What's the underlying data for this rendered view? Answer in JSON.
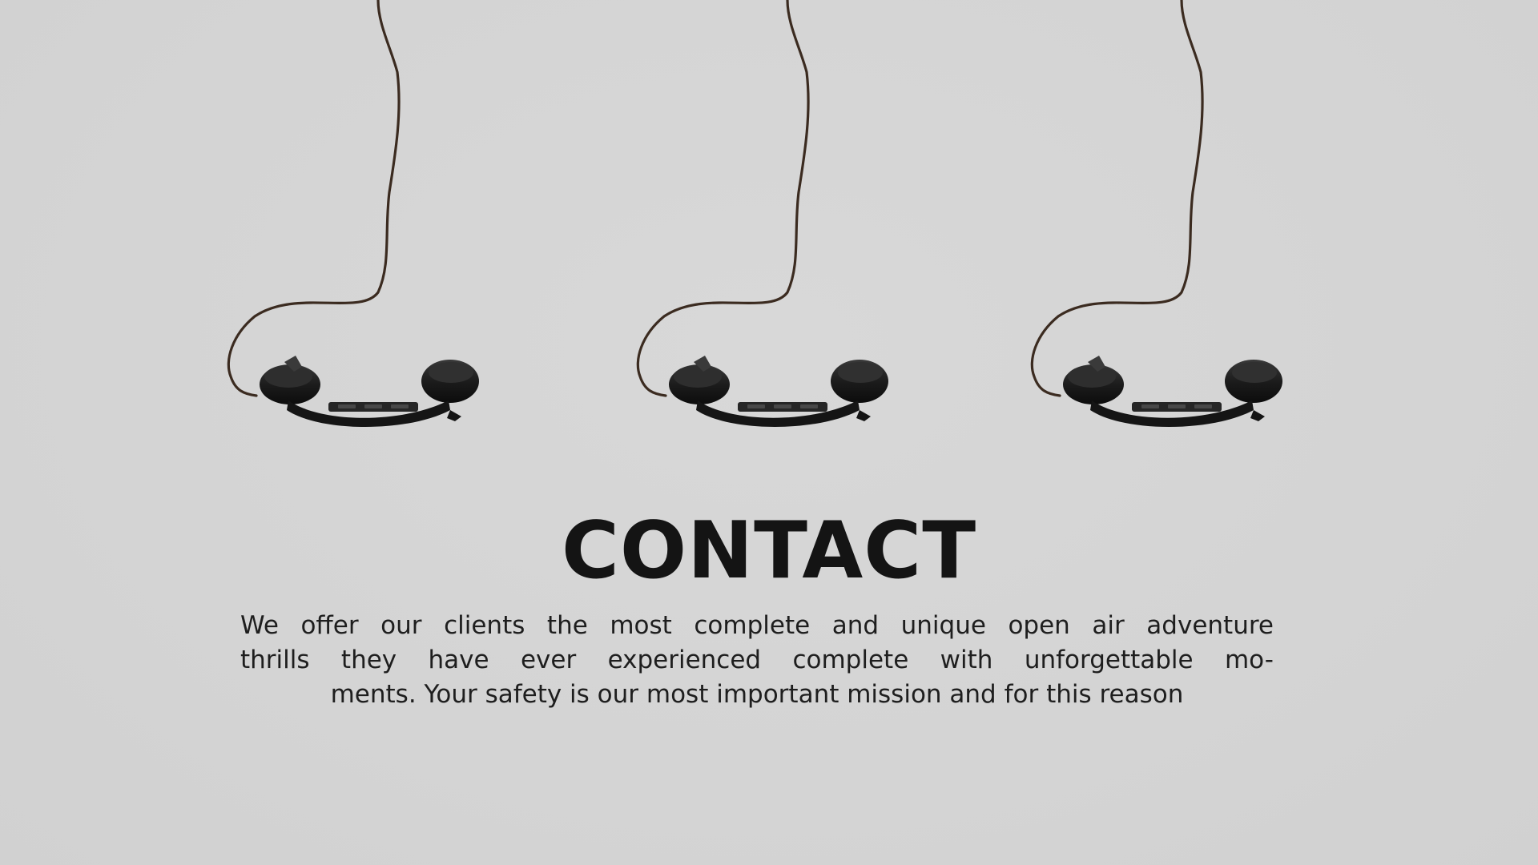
{
  "contact": {
    "title": "CONTACT",
    "description_lines": [
      "We offer our clients the most complete and unique open air adventure",
      "thrills they have ever experienced complete with unforgettable mo-",
      "ments. Your safety is our most important mission and for this reason"
    ]
  },
  "images": {
    "phones": [
      {
        "name": "hanging-telephone-receiver-icon"
      },
      {
        "name": "hanging-telephone-receiver-icon"
      },
      {
        "name": "hanging-telephone-receiver-icon"
      }
    ]
  },
  "colors": {
    "background": "#d4d4d4",
    "cord": "#3b2b20",
    "receiver": "#1b1b1b",
    "text": "#141414"
  }
}
